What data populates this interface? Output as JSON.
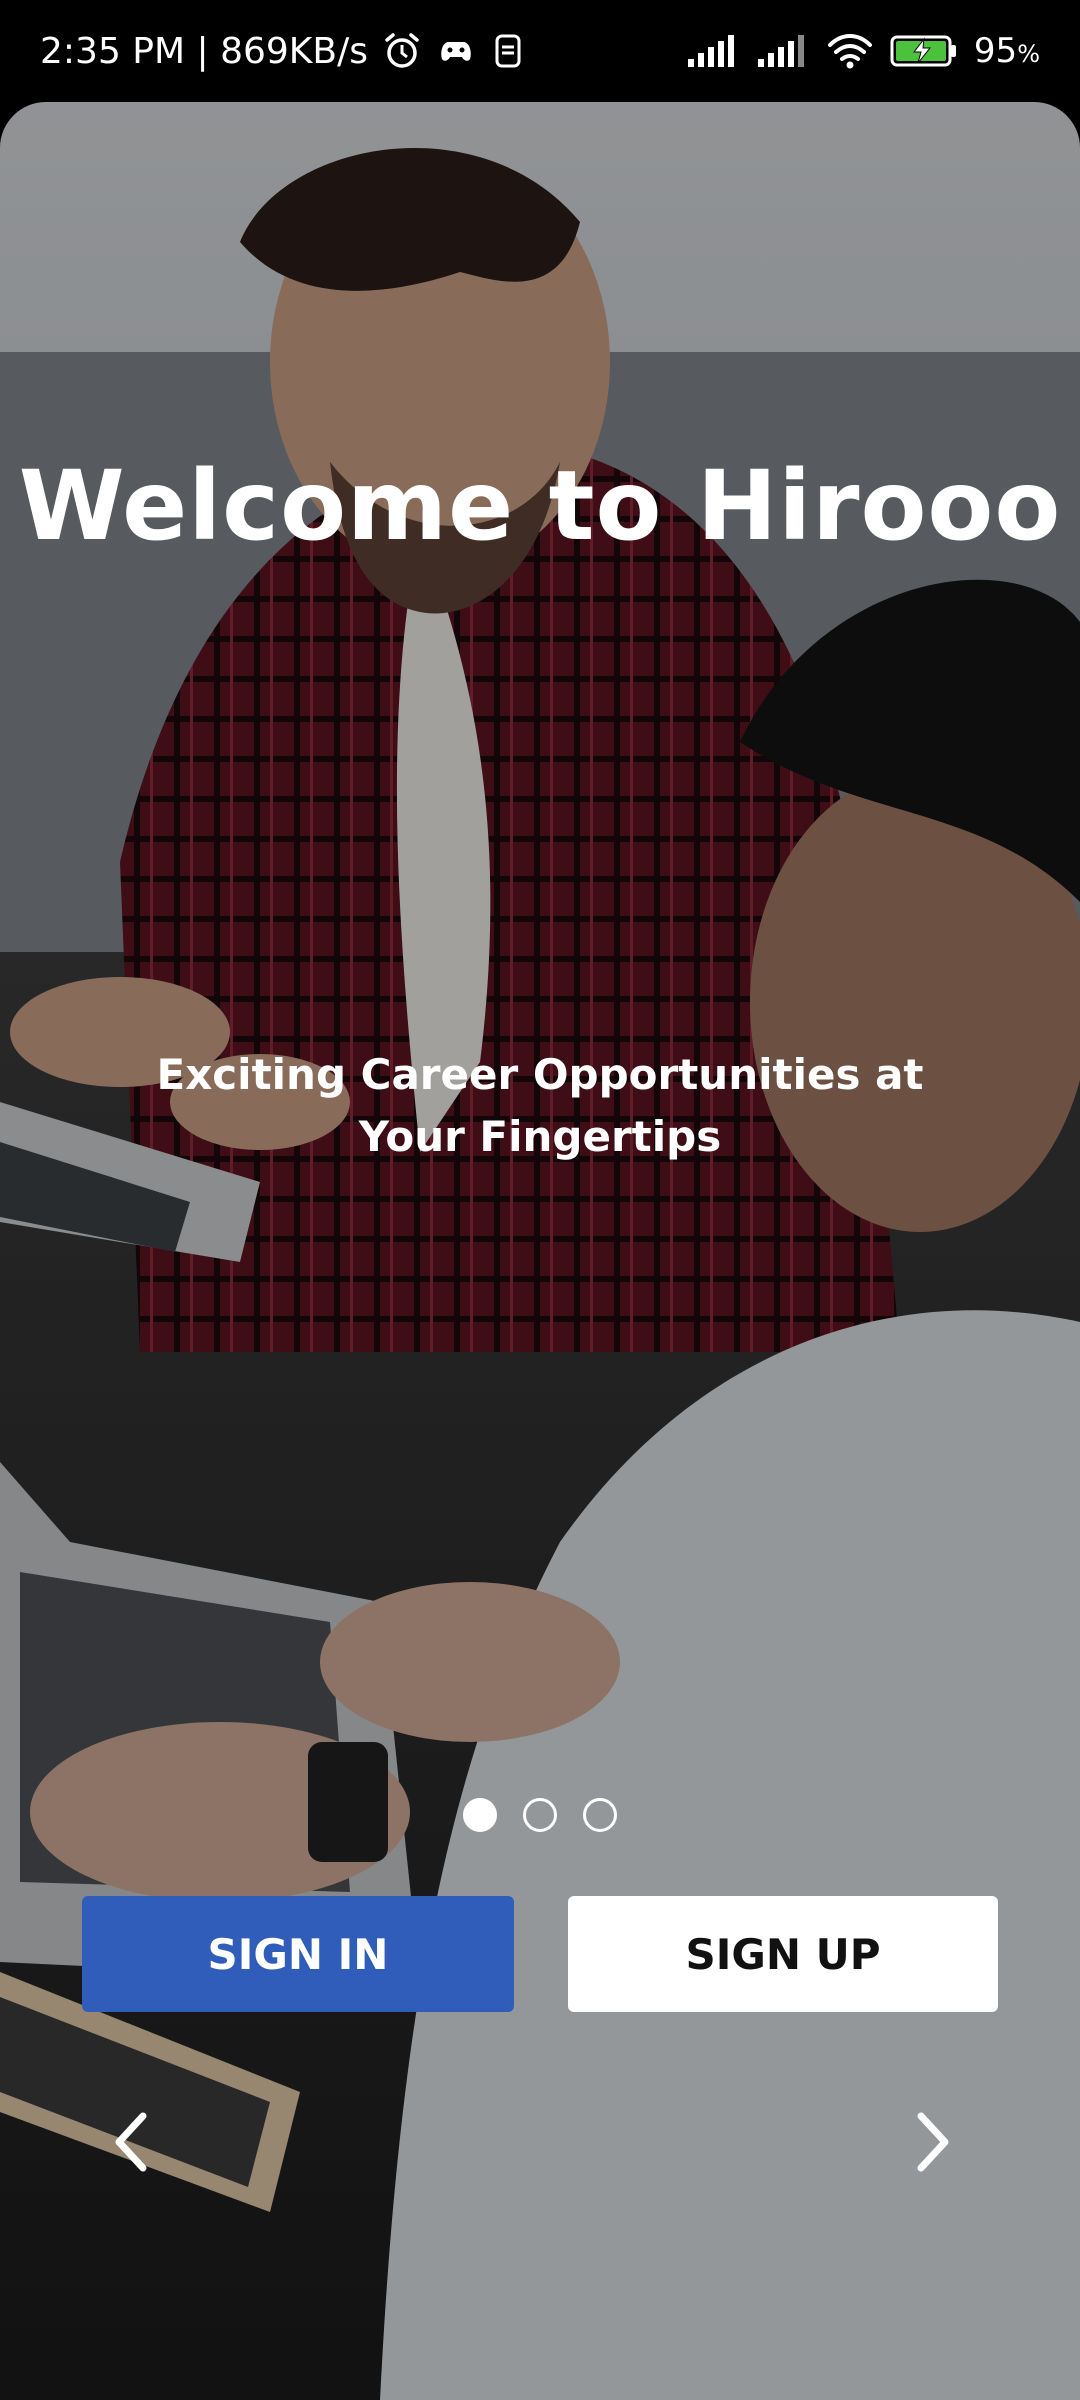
{
  "status_bar": {
    "time_speed": "2:35 PM | 869KB/s",
    "battery": "95",
    "battery_unit": "%",
    "icons": [
      "alarm-icon",
      "game-controller-icon",
      "sim-icon",
      "signal-icon",
      "signal-icon",
      "wifi-icon",
      "battery-charging-icon"
    ]
  },
  "hero": {
    "title": "Welcome to Hirooo",
    "subtitle": "Exciting Career Opportunities at Your Fingertips"
  },
  "carousel": {
    "total": 3,
    "active_index": 0
  },
  "buttons": {
    "sign_in": "SIGN IN",
    "sign_up": "SIGN UP"
  },
  "colors": {
    "primary": "#2f5db9",
    "secondary_button": "#ffffff"
  }
}
